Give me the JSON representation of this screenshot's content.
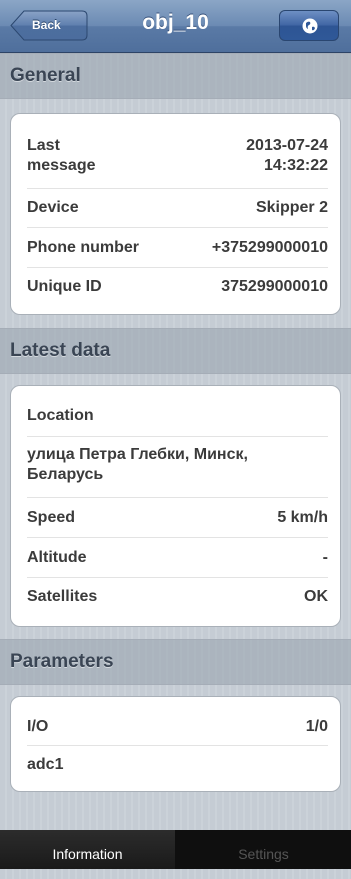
{
  "nav": {
    "back_label": "Back",
    "title": "obj_10",
    "action_icon": "globe-icon"
  },
  "sections": {
    "general": {
      "header": "General",
      "rows": [
        {
          "label_line1": "Last",
          "label_line2": "message",
          "value_line1": "2013-07-24",
          "value_line2": "14:32:22"
        },
        {
          "label": "Device",
          "value": "Skipper 2"
        },
        {
          "label": "Phone number",
          "value": "+375299000010"
        },
        {
          "label": "Unique ID",
          "value": "375299000010"
        }
      ]
    },
    "latest": {
      "header": "Latest data",
      "location_label": "Location",
      "address_line1": "улица Петра Глебки, Минск,",
      "address_line2": "Беларусь",
      "rows": [
        {
          "label": "Speed",
          "value": "5 km/h"
        },
        {
          "label": "Altitude",
          "value": "-"
        },
        {
          "label": "Satellites",
          "value": "OK"
        }
      ]
    },
    "parameters": {
      "header": "Parameters",
      "rows": [
        {
          "label": "I/O",
          "value": "1/0"
        },
        {
          "label": "adc1",
          "value": ""
        }
      ]
    }
  },
  "tabs": [
    {
      "label": "Information",
      "active": true
    },
    {
      "label": "Settings",
      "active": false
    }
  ],
  "colors": {
    "navbar": "#6b8ab3",
    "tabbar": "#0f0f0f",
    "text": "#3b3b3b"
  }
}
